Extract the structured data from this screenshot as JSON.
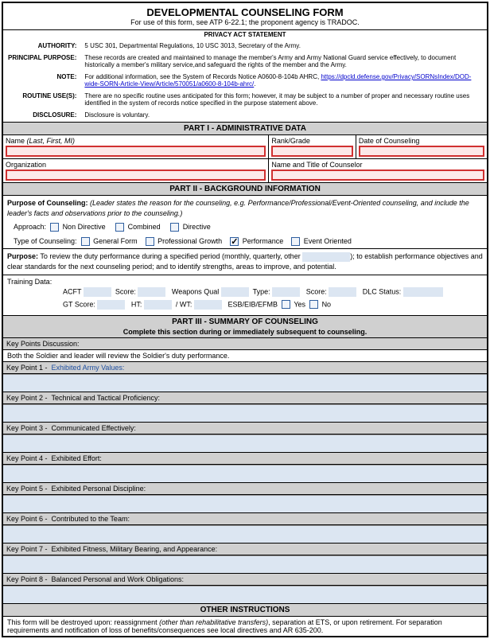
{
  "header": {
    "title": "DEVELOPMENTAL COUNSELING FORM",
    "subtitle": "For use of this form, see ATP 6-22.1; the proponent agency is TRADOC."
  },
  "privacy": {
    "heading": "PRIVACY ACT STATEMENT",
    "authority_label": "AUTHORITY:",
    "authority": "5 USC 301, Departmental Regulations, 10 USC 3013, Secretary of the Army.",
    "purpose_label": "PRINCIPAL PURPOSE:",
    "purpose": "These records are created and maintained to manage the member's Army and Army National Guard service effectively, to document historically a member's military service,and safeguard the rights of the member and the Army.",
    "note_label": "NOTE:",
    "note_pre": "For additional information, see the System of Records Notice A0600-8-104b AHRC, ",
    "note_link": "https://dpcld.defense.gov/Privacy/SORNsIndex/DOD-wide-SORN-Article-View/Article/570051/a0600-8-104b-ahrc/",
    "note_post": ".",
    "routine_label": "ROUTINE USE(S):",
    "routine": "There are no specific routine uses anticipated for this form; however, it may be subject to a number of proper and necessary routine uses identified in the system of records notice specified in the purpose statement above.",
    "disclosure_label": "DISCLOSURE:",
    "disclosure": "Disclosure is voluntary."
  },
  "part1": {
    "heading": "PART I - ADMINISTRATIVE DATA",
    "name_label": "Name ",
    "name_hint": "(Last, First, MI)",
    "rank_label": "Rank/Grade",
    "date_label": "Date of Counseling",
    "org_label": "Organization",
    "counselor_label": "Name and Title of Counselor"
  },
  "part2": {
    "heading": "PART II - BACKGROUND INFORMATION",
    "purpose_title": "Purpose of Counseling:",
    "purpose_hint": "(Leader states the reason for the counseling, e.g. Performance/Professional/Event-Oriented counseling, and include the leader's facts and observations prior to the counseling.)",
    "approach_label": "Approach:",
    "approach_nd": "Non Directive",
    "approach_comb": "Combined",
    "approach_dir": "Directive",
    "type_label": "Type of Counseling:",
    "type_gen": "General Form",
    "type_prof": "Professional Growth",
    "type_perf": "Performance",
    "type_event": "Event Oriented",
    "p_label": "Purpose:",
    "p_pre": "To review the duty performance during a specified period (monthly, quarterly, other ",
    "p_post": "); to establish performance objectives and clear standards for the next counseling period; and to identify strengths, areas to improve, and potential.",
    "training_label": "Training Data:",
    "acft": "ACFT",
    "score": "Score:",
    "weapons": "Weapons Qual",
    "type": "Type:",
    "dlc": "DLC Status:",
    "gt": "GT Score:",
    "ht": "HT:",
    "wt": "/ WT:",
    "esb": "ESB/EIB/EFMB",
    "yes": "Yes",
    "no": "No"
  },
  "part3": {
    "heading": "PART III - SUMMARY OF COUNSELING",
    "sub": "Complete this section during or immediately subsequent to counseling.",
    "kpd": "Key Points Discussion:",
    "kpd_text": "Both the Soldier and leader will review the Soldier's duty performance.",
    "kp1": "Key Point 1 -",
    "kp1_t": "Exhibited Army Values:",
    "kp2": "Key Point 2 -",
    "kp2_t": "Technical and Tactical Proficiency:",
    "kp3": "Key Point 3 -",
    "kp3_t": "Communicated Effectively:",
    "kp4": "Key Point 4 -",
    "kp4_t": "Exhibited Effort:",
    "kp5": "Key Point 5 -",
    "kp5_t": "Exhibited Personal Discipline:",
    "kp6": "Key Point 6 -",
    "kp6_t": "Contributed to the Team:",
    "kp7": "Key Point 7 -",
    "kp7_t": "Exhibited Fitness, Military Bearing, and Appearance:",
    "kp8": "Key Point 8 -",
    "kp8_t": "Balanced Personal and Work Obligations:"
  },
  "other": {
    "heading": "OTHER INSTRUCTIONS",
    "t1": "This form will be destroyed upon: reassignment ",
    "t2": "(other than rehabilitative transfers)",
    "t3": ", separation at ETS, or upon retirement. For separation requirements and notification of loss of benefits/consequences see local directives and AR 635-200."
  }
}
